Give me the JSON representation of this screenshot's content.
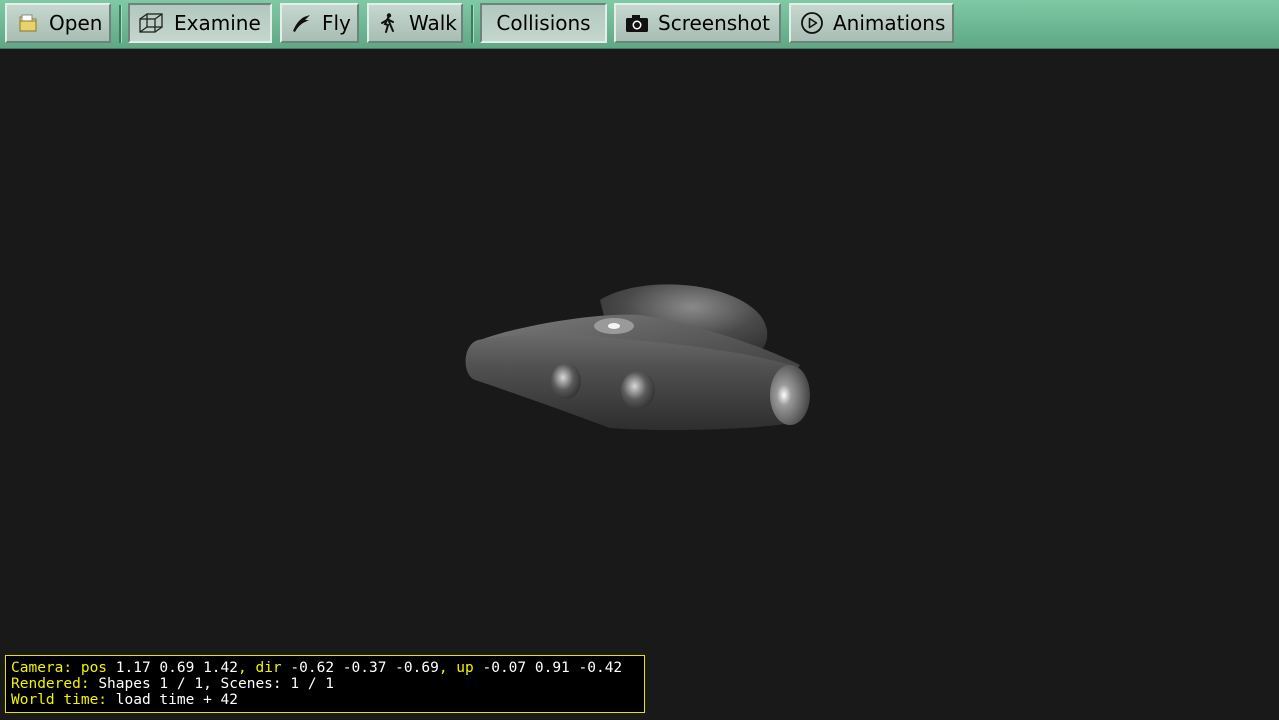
{
  "toolbar": {
    "buttons": [
      {
        "label": "Open",
        "icon": "folder-icon"
      },
      {
        "label": "Examine",
        "icon": "cube-wireframe-icon",
        "pressed": true
      },
      {
        "label": "Fly",
        "icon": "bird-icon"
      },
      {
        "label": "Walk",
        "icon": "walking-person-icon"
      },
      {
        "label": "Collisions",
        "pressed": true
      },
      {
        "label": "Screenshot",
        "icon": "camera-icon"
      },
      {
        "label": "Animations",
        "icon": "play-circle-icon"
      }
    ]
  },
  "scene": {
    "background": "#191919",
    "model": "metal-bracket"
  },
  "status": {
    "camera": {
      "label": "Camera:",
      "pos_label": "pos",
      "pos": "1.17 0.69 1.42",
      "dir_label": "dir",
      "dir": "-0.62 -0.37 -0.69",
      "up_label": "up",
      "up": "-0.07 0.91 -0.42"
    },
    "rendered": {
      "label": "Rendered:",
      "value": "Shapes 1 / 1, Scenes: 1 / 1"
    },
    "world_time": {
      "label": "World time:",
      "value": "load time + 42"
    }
  },
  "colors": {
    "toolbar": "#6fb995",
    "hud_key": "#f3f300",
    "hud_border": "#e4e400"
  }
}
